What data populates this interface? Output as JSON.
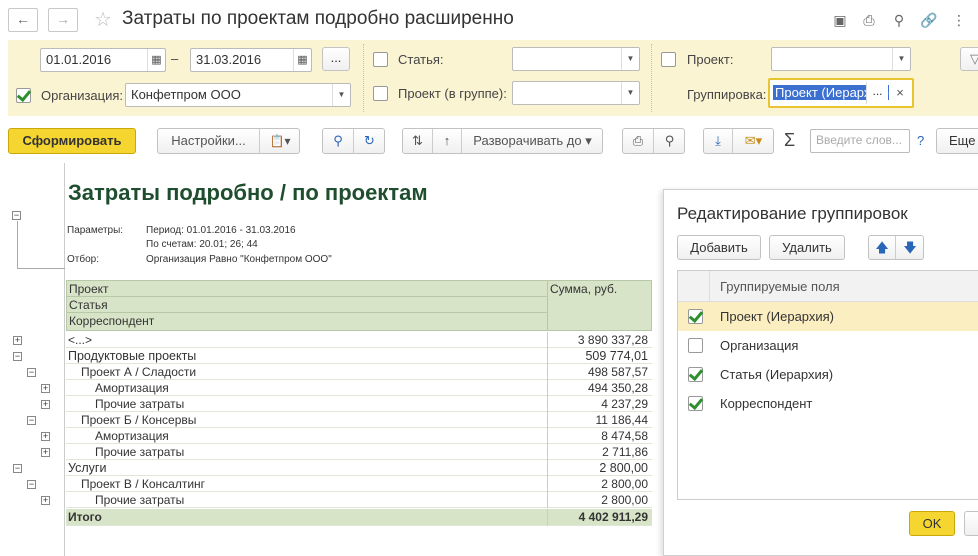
{
  "window": {
    "title": "Затраты по проектам подробно расширенно"
  },
  "filters": {
    "date_from": "01.01.2016",
    "date_to": "31.03.2016",
    "date_dash": "–",
    "more_button": "...",
    "organization": {
      "label": "Организация:",
      "value": "Конфетпром ООО",
      "checked": true
    },
    "article": {
      "label": "Статья:",
      "value": "",
      "checked": false
    },
    "project_group": {
      "label": "Проект (в группе):",
      "value": "",
      "checked": false
    },
    "project": {
      "label": "Проект:",
      "value": "",
      "checked": false
    },
    "grouping": {
      "label": "Группировка:",
      "value": "Проект (Иерархия)",
      "dots": "...",
      "clear": "×"
    }
  },
  "toolbar": {
    "generate": "Сформировать",
    "settings": "Настройки...",
    "expand_to": "Разворачивать до",
    "search_placeholder": "Введите слов...",
    "help": "?",
    "more": "Еще",
    "sigma": "Σ"
  },
  "report": {
    "title": "Затраты подробно / по проектам",
    "params_label": "Параметры:",
    "params_value_1": "Период: 01.01.2016 - 31.03.2016",
    "params_value_2": "По счетам: 20.01; 26; 44",
    "filter_label": "Отбор:",
    "filter_value": "Организация Равно \"Конфетпром ООО\"",
    "header": {
      "col1_line1": "Проект",
      "col1_line2": "Статья",
      "col1_line3": "Корреспондент",
      "col2": "Сумма, руб."
    },
    "rows": [
      {
        "name": "<...>",
        "value": "3 890 337,28"
      },
      {
        "name": "Продуктовые проекты",
        "value": "509 774,01"
      },
      {
        "name": "Проект А / Сладости",
        "value": "498 587,57"
      },
      {
        "name": "Амортизация",
        "value": "494 350,28"
      },
      {
        "name": "Прочие затраты",
        "value": "4 237,29"
      },
      {
        "name": "Проект Б / Консервы",
        "value": "11 186,44"
      },
      {
        "name": "Амортизация",
        "value": "8 474,58"
      },
      {
        "name": "Прочие затраты",
        "value": "2 711,86"
      },
      {
        "name": "Услуги",
        "value": "2 800,00"
      },
      {
        "name": "Проект В / Консалтинг",
        "value": "2 800,00"
      },
      {
        "name": "Прочие затраты",
        "value": "2 800,00"
      }
    ],
    "total": {
      "name": "Итого",
      "value": "4 402 911,29"
    }
  },
  "dialog": {
    "title": "Редактирование группировок",
    "add": "Добавить",
    "delete": "Удалить",
    "column_header": "Группируемые поля",
    "items": [
      {
        "label": "Проект (Иерархия)",
        "checked": true
      },
      {
        "label": "Организация",
        "checked": false
      },
      {
        "label": "Статья (Иерархия)",
        "checked": true
      },
      {
        "label": "Корреспондент",
        "checked": true
      }
    ],
    "ok": "OK"
  }
}
